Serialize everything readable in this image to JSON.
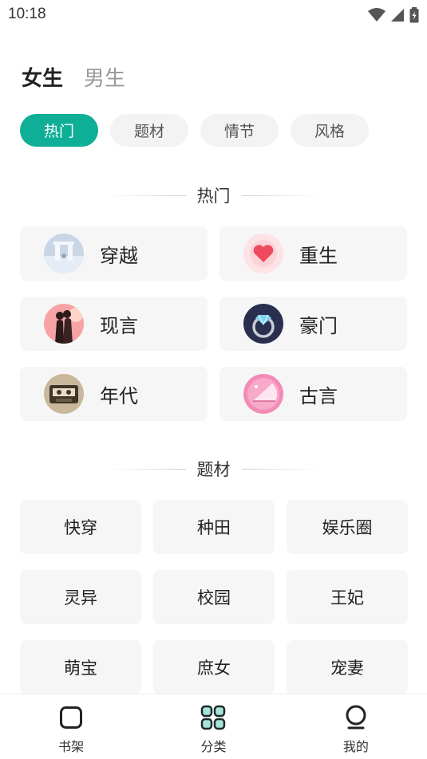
{
  "status_bar": {
    "time": "10:18"
  },
  "gender_tabs": [
    {
      "label": "女生",
      "active": true
    },
    {
      "label": "男生",
      "active": false
    }
  ],
  "filter_chips": [
    {
      "label": "热门",
      "active": true
    },
    {
      "label": "题材",
      "active": false
    },
    {
      "label": "情节",
      "active": false
    },
    {
      "label": "风格",
      "active": false
    }
  ],
  "sections": {
    "hot_title": "热门",
    "topic_title": "题材"
  },
  "hot_items": [
    {
      "label": "穿越",
      "icon": "time-gate-icon"
    },
    {
      "label": "重生",
      "icon": "heart-icon"
    },
    {
      "label": "现言",
      "icon": "couple-icon"
    },
    {
      "label": "豪门",
      "icon": "ring-icon"
    },
    {
      "label": "年代",
      "icon": "cassette-icon"
    },
    {
      "label": "古言",
      "icon": "fan-icon"
    }
  ],
  "topic_items": [
    {
      "label": "快穿"
    },
    {
      "label": "种田"
    },
    {
      "label": "娱乐圈"
    },
    {
      "label": "灵异"
    },
    {
      "label": "校园"
    },
    {
      "label": "王妃"
    },
    {
      "label": "萌宝"
    },
    {
      "label": "庶女"
    },
    {
      "label": "宠妻"
    }
  ],
  "bottom_nav": [
    {
      "label": "书架",
      "icon": "bookshelf-icon"
    },
    {
      "label": "分类",
      "icon": "category-icon"
    },
    {
      "label": "我的",
      "icon": "profile-icon"
    }
  ],
  "colors": {
    "accent": "#0fae97",
    "chip_bg": "#f3f3f3",
    "card_bg": "#f6f6f6"
  }
}
